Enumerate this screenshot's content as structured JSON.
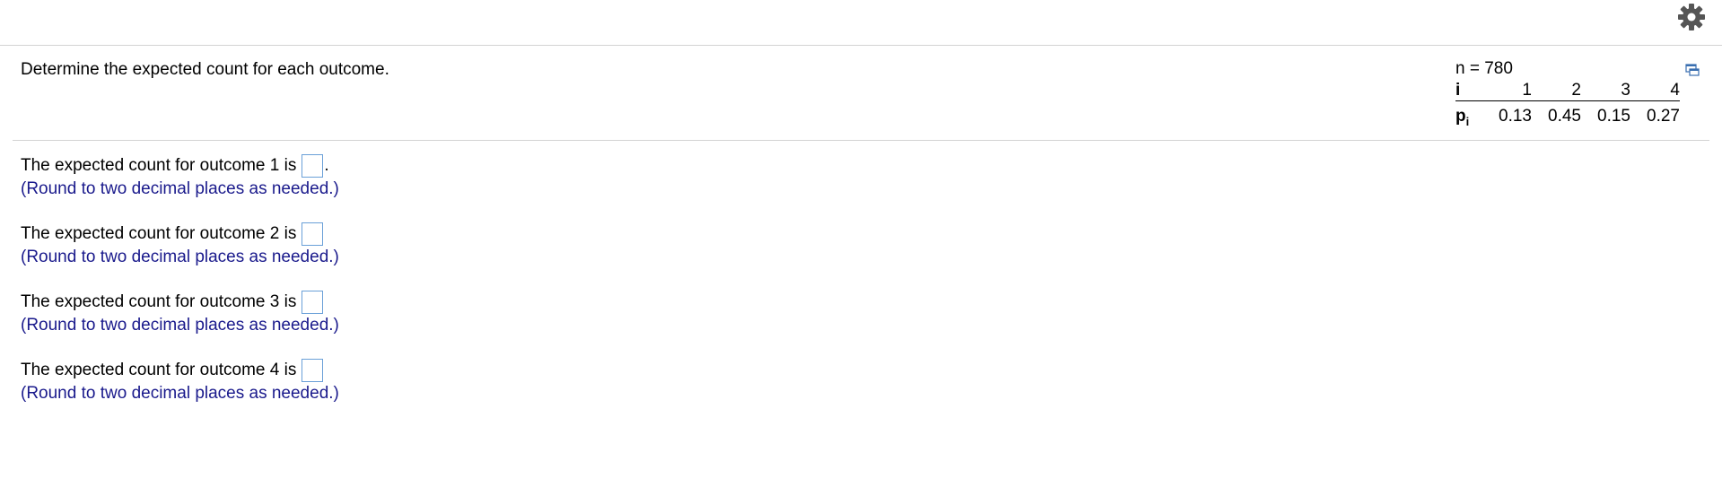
{
  "question": "Determine the expected count for each outcome.",
  "data_panel": {
    "n_label": "n = 780",
    "row_i_header": "i",
    "row_p_header": "p",
    "row_p_sub": "i",
    "i_values": [
      "1",
      "2",
      "3",
      "4"
    ],
    "p_values": [
      "0.13",
      "0.45",
      "0.15",
      "0.27"
    ]
  },
  "answers": [
    {
      "prompt": "The expected count for outcome 1 is",
      "value": "",
      "suffix": ".",
      "hint": "(Round to two decimal places as needed.)"
    },
    {
      "prompt": "The expected count for outcome 2 is",
      "value": "",
      "suffix": "",
      "hint": "(Round to two decimal places as needed.)"
    },
    {
      "prompt": "The expected count for outcome 3 is",
      "value": "",
      "suffix": "",
      "hint": "(Round to two decimal places as needed.)"
    },
    {
      "prompt": "The expected count for outcome 4 is",
      "value": "",
      "suffix": "",
      "hint": "(Round to two decimal places as needed.)"
    }
  ],
  "icons": {
    "settings": "gear-icon",
    "popup": "popup-window-icon"
  },
  "colors": {
    "hint_text": "#1a1a8c",
    "input_border": "#6aa0d8",
    "gear": "#555555",
    "rule": "#d3d3d3"
  }
}
